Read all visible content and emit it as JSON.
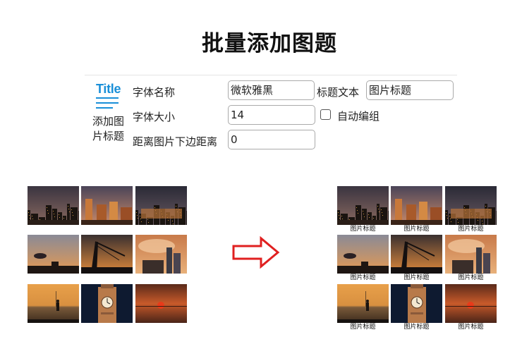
{
  "page_title": "批量添加图题",
  "logo": {
    "text": "Title",
    "caption": "添加图片标题"
  },
  "form": {
    "font_name_label": "字体名称",
    "font_name_value": "微软雅黑",
    "caption_text_label": "标题文本",
    "caption_text_value": "图片标题",
    "font_size_label": "字体大小",
    "font_size_value": "14",
    "auto_group_label": "自动编组",
    "auto_group_checked": false,
    "distance_label": "距离图片下边距离",
    "distance_value": "0"
  },
  "before": {
    "photos": [
      "city-dusk-skyline",
      "city-dusk-bund",
      "city-dusk-towers",
      "orange-sky-cloud",
      "crane-silhouette",
      "sunset-clouds-towers",
      "woman-waterfront",
      "clock-tower-night",
      "red-sunset-sea"
    ]
  },
  "after": {
    "captions": [
      "图片标题",
      "图片标题",
      "图片标题",
      "图片标题",
      "图片标题",
      "图片标题",
      "图片标题",
      "图片标题",
      "图片标题"
    ]
  },
  "arrow_color": "#e02020",
  "accent_color": "#1a8fd8"
}
